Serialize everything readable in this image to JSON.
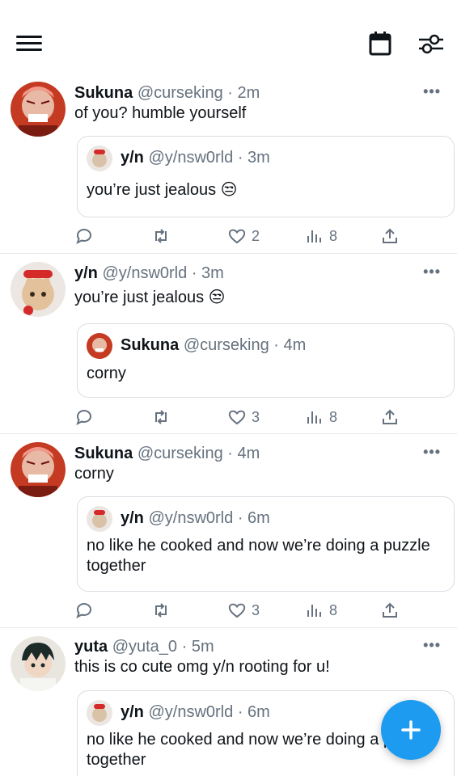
{
  "header": {
    "menu_icon": "hamburger-menu-icon",
    "calendar_icon": "calendar-icon",
    "filter_icon": "sliders-icon"
  },
  "colors": {
    "accent": "#1d9bf0",
    "text": "#0f1419",
    "muted": "#66727f",
    "border": "#d9dee3"
  },
  "tweets": [
    {
      "name": "Sukuna",
      "handle": "@curseking",
      "separator": "·",
      "time": "2m",
      "text": "of you? humble yourself",
      "quote": {
        "name": "y/n",
        "handle": "@y/nsw0rld",
        "separator": "·",
        "time": "3m",
        "text": "you’re just jealous 😒"
      },
      "likes": "2",
      "views": "8"
    },
    {
      "name": "y/n",
      "handle": "@y/nsw0rld",
      "separator": "·",
      "time": "3m",
      "text": "you’re just jealous 😒",
      "quote": {
        "name": "Sukuna",
        "handle": "@curseking",
        "separator": "·",
        "time": "4m",
        "text": "corny"
      },
      "likes": "3",
      "views": "8"
    },
    {
      "name": "Sukuna",
      "handle": "@curseking",
      "separator": "·",
      "time": "4m",
      "text": "corny",
      "quote": {
        "name": "y/n",
        "handle": "@y/nsw0rld",
        "separator": "·",
        "time": "6m",
        "text": "no like he cooked and now we’re doing a puzzle together"
      },
      "likes": "3",
      "views": "8"
    },
    {
      "name": "yuta",
      "handle": "@yuta_0",
      "separator": "·",
      "time": "5m",
      "text": "this is co cute omg y/n rooting for u!",
      "quote": {
        "name": "y/n",
        "handle": "@y/nsw0rld",
        "separator": "·",
        "time": "6m",
        "text": "no like he cooked and now we’re doing a puzzle together"
      }
    }
  ],
  "more_label": "•••",
  "fab": {
    "label": "+",
    "icon": "compose-plus-icon"
  }
}
